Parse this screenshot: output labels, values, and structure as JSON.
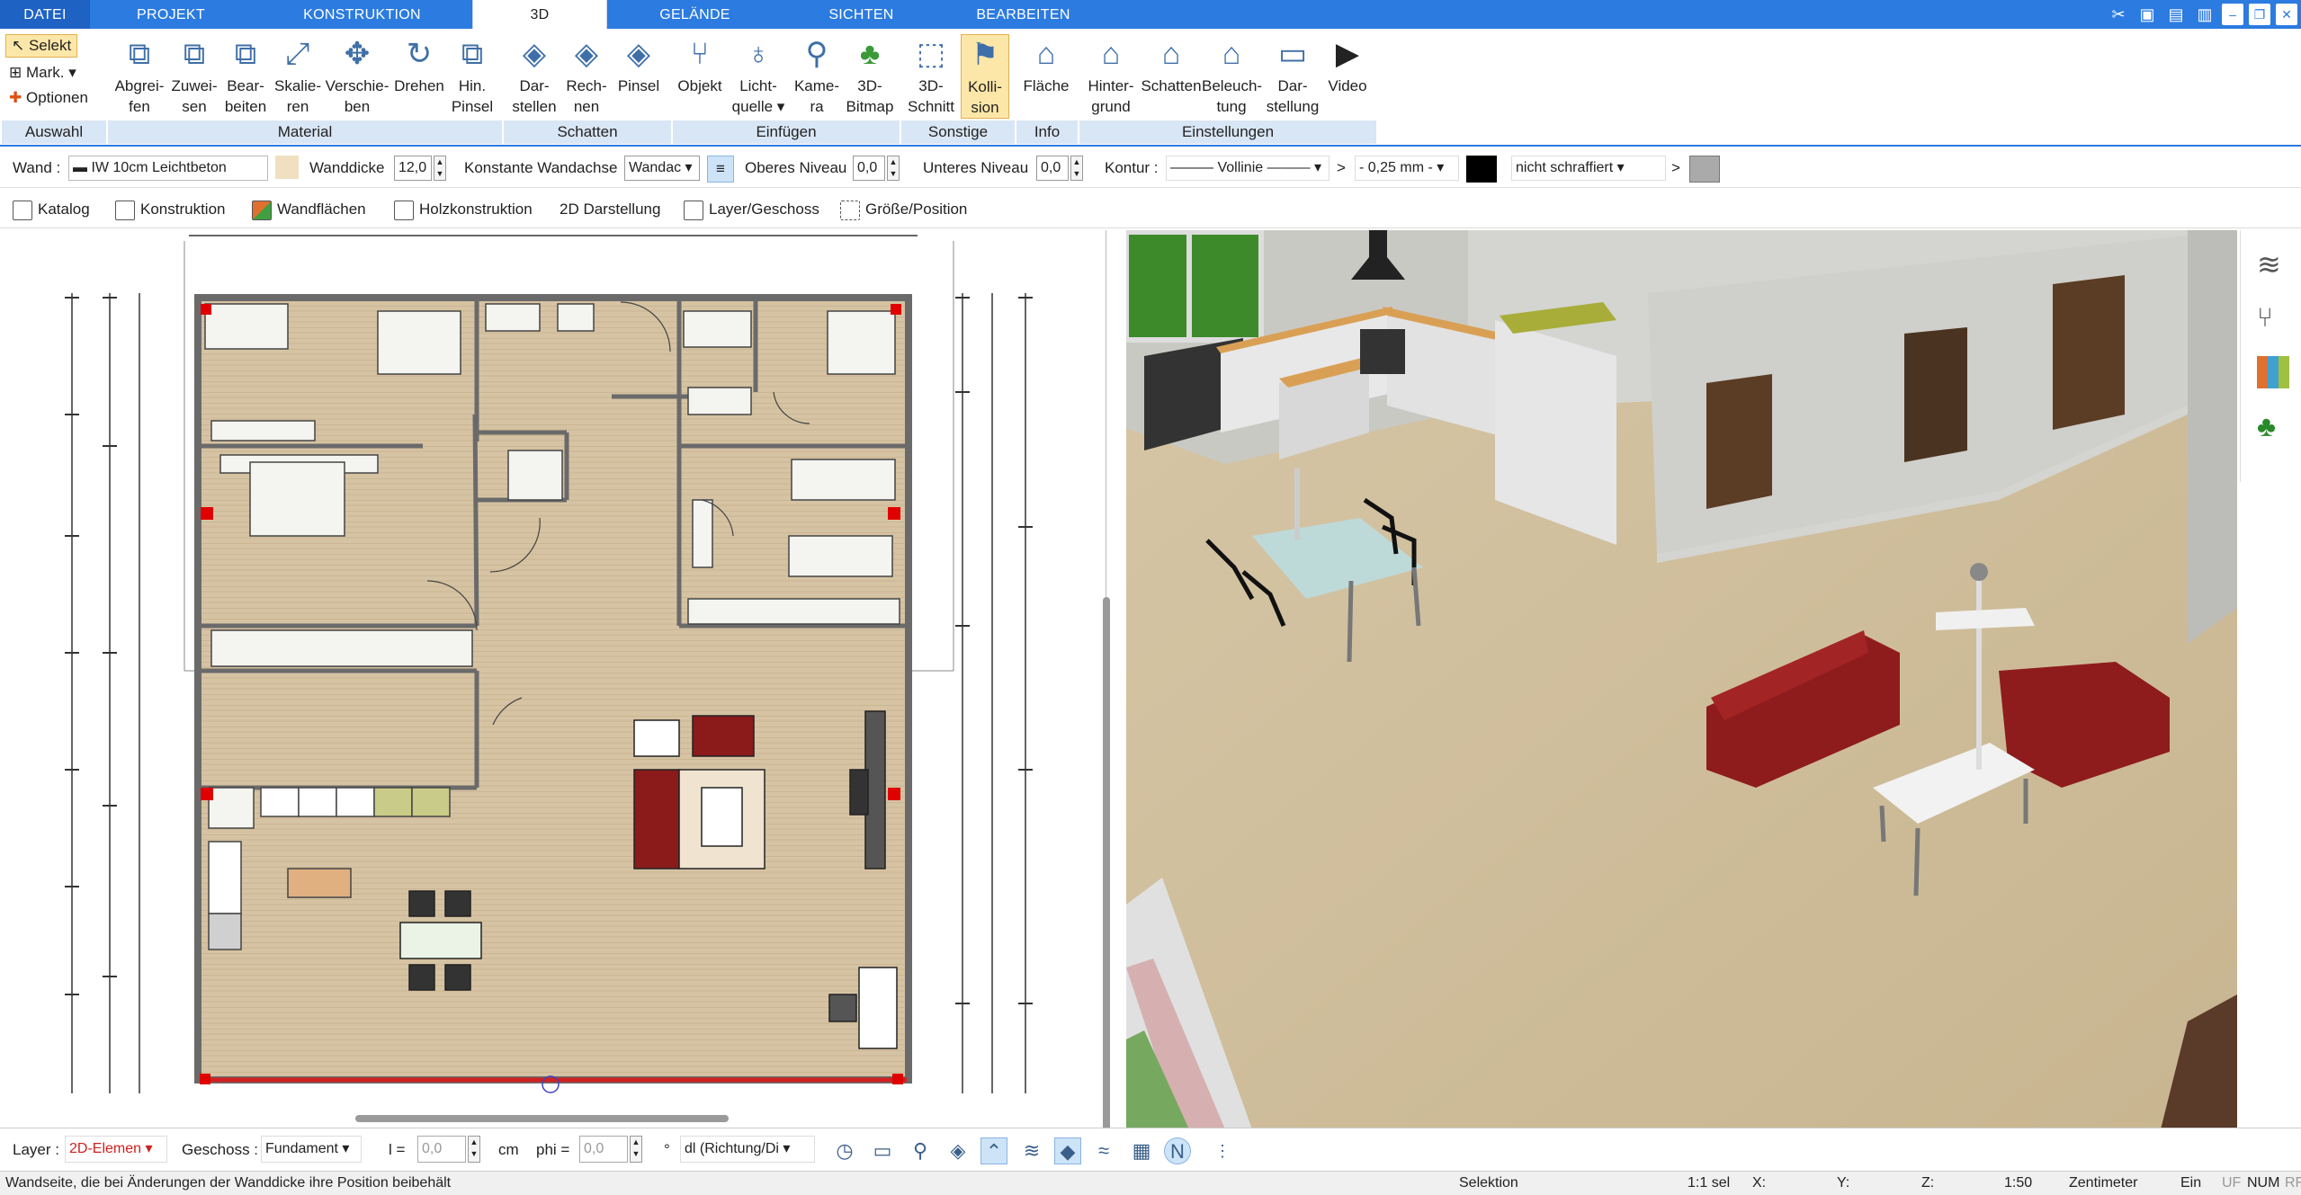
{
  "menu": {
    "tabs": [
      "DATEI",
      "PROJEKT",
      "KONSTRUKTION",
      "3D",
      "GELÄNDE",
      "SICHTEN",
      "BEARBEITEN"
    ],
    "active": "3D"
  },
  "ribbon": {
    "auswahl": {
      "selekt": "Selekt",
      "mark": "Mark.",
      "optionen": "Optionen",
      "group": "Auswahl"
    },
    "material": {
      "group": "Material",
      "buttons": [
        [
          "Abgrei-",
          "fen"
        ],
        [
          "Zuwei-",
          "sen"
        ],
        [
          "Bear-",
          "beiten"
        ],
        [
          "Skalie-",
          "ren"
        ],
        [
          "Verschie-",
          "ben"
        ],
        [
          "Drehen",
          ""
        ],
        [
          "Hin.",
          "Pinsel"
        ]
      ]
    },
    "schatten": {
      "group": "Schatten",
      "buttons": [
        [
          "Dar-",
          "stellen"
        ],
        [
          "Rech-",
          "nen"
        ],
        [
          "Pinsel",
          ""
        ]
      ]
    },
    "einfuegen": {
      "group": "Einfügen",
      "buttons": [
        [
          "Objekt",
          ""
        ],
        [
          "Licht-",
          "quelle"
        ],
        [
          "Kame-",
          "ra"
        ],
        [
          "3D-",
          "Bitmap"
        ]
      ]
    },
    "sonstige": {
      "group": "Sonstige",
      "buttons": [
        [
          "3D-",
          "Schnitt"
        ],
        [
          "Kolli-",
          "sion"
        ]
      ]
    },
    "info": {
      "group": "Info",
      "buttons": [
        [
          "Fläche",
          ""
        ]
      ]
    },
    "einstellungen": {
      "group": "Einstellungen",
      "buttons": [
        [
          "Hinter-",
          "grund"
        ],
        [
          "Schatten",
          ""
        ],
        [
          "Beleuch-",
          "tung"
        ],
        [
          "Dar-",
          "stellung"
        ],
        [
          "Video",
          ""
        ]
      ]
    }
  },
  "props": {
    "wand_label": "Wand :",
    "wand_value": "IW 10cm Leichtbeton",
    "wanddicke_label": "Wanddicke",
    "wanddicke": "12,0",
    "konst_label": "Konstante Wandachse",
    "konst_value": "Wandac",
    "oberes_label": "Oberes Niveau",
    "oberes": "0,0",
    "unteres_label": "Unteres Niveau",
    "unteres": "0,0",
    "kontur_label": "Kontur :",
    "kontur_value": "Vollinie",
    "gt1": ">",
    "mm_value": "- 0,25 mm -",
    "schraffur": "nicht schraffiert",
    "gt2": ">"
  },
  "toolbar2": [
    "Katalog",
    "Konstruktion",
    "Wandflächen",
    "Holzkonstruktion",
    "2D Darstellung",
    "Layer/Geschoss",
    "Größe/Position"
  ],
  "bottom": {
    "layer_label": "Layer :",
    "layer_value": "2D-Elemen",
    "geschoss_label": "Geschoss :",
    "geschoss_value": "Fundament",
    "l_label": "l =",
    "l_value": "0,0",
    "cm": "cm",
    "phi_label": "phi =",
    "phi_value": "0,0",
    "deg": "°",
    "dl_value": "dl (Richtung/Di"
  },
  "status": {
    "hint": "Wandseite, die bei Änderungen der Wanddicke ihre Position beibehält",
    "mode": "Selektion",
    "sel": "1:1 sel",
    "x": "X:",
    "y": "Y:",
    "z": "Z:",
    "scale": "1:50",
    "unit": "Zentimeter",
    "ein": "Ein",
    "uf": "UF",
    "num": "NUM",
    "rf": "RF"
  },
  "colors": {
    "menubar": "#2b7be0",
    "ribbon_group": "#d9e6f5",
    "active_btn": "#fde7a8",
    "floor": "#cdb89a",
    "sofa": "#8b1a1a"
  }
}
